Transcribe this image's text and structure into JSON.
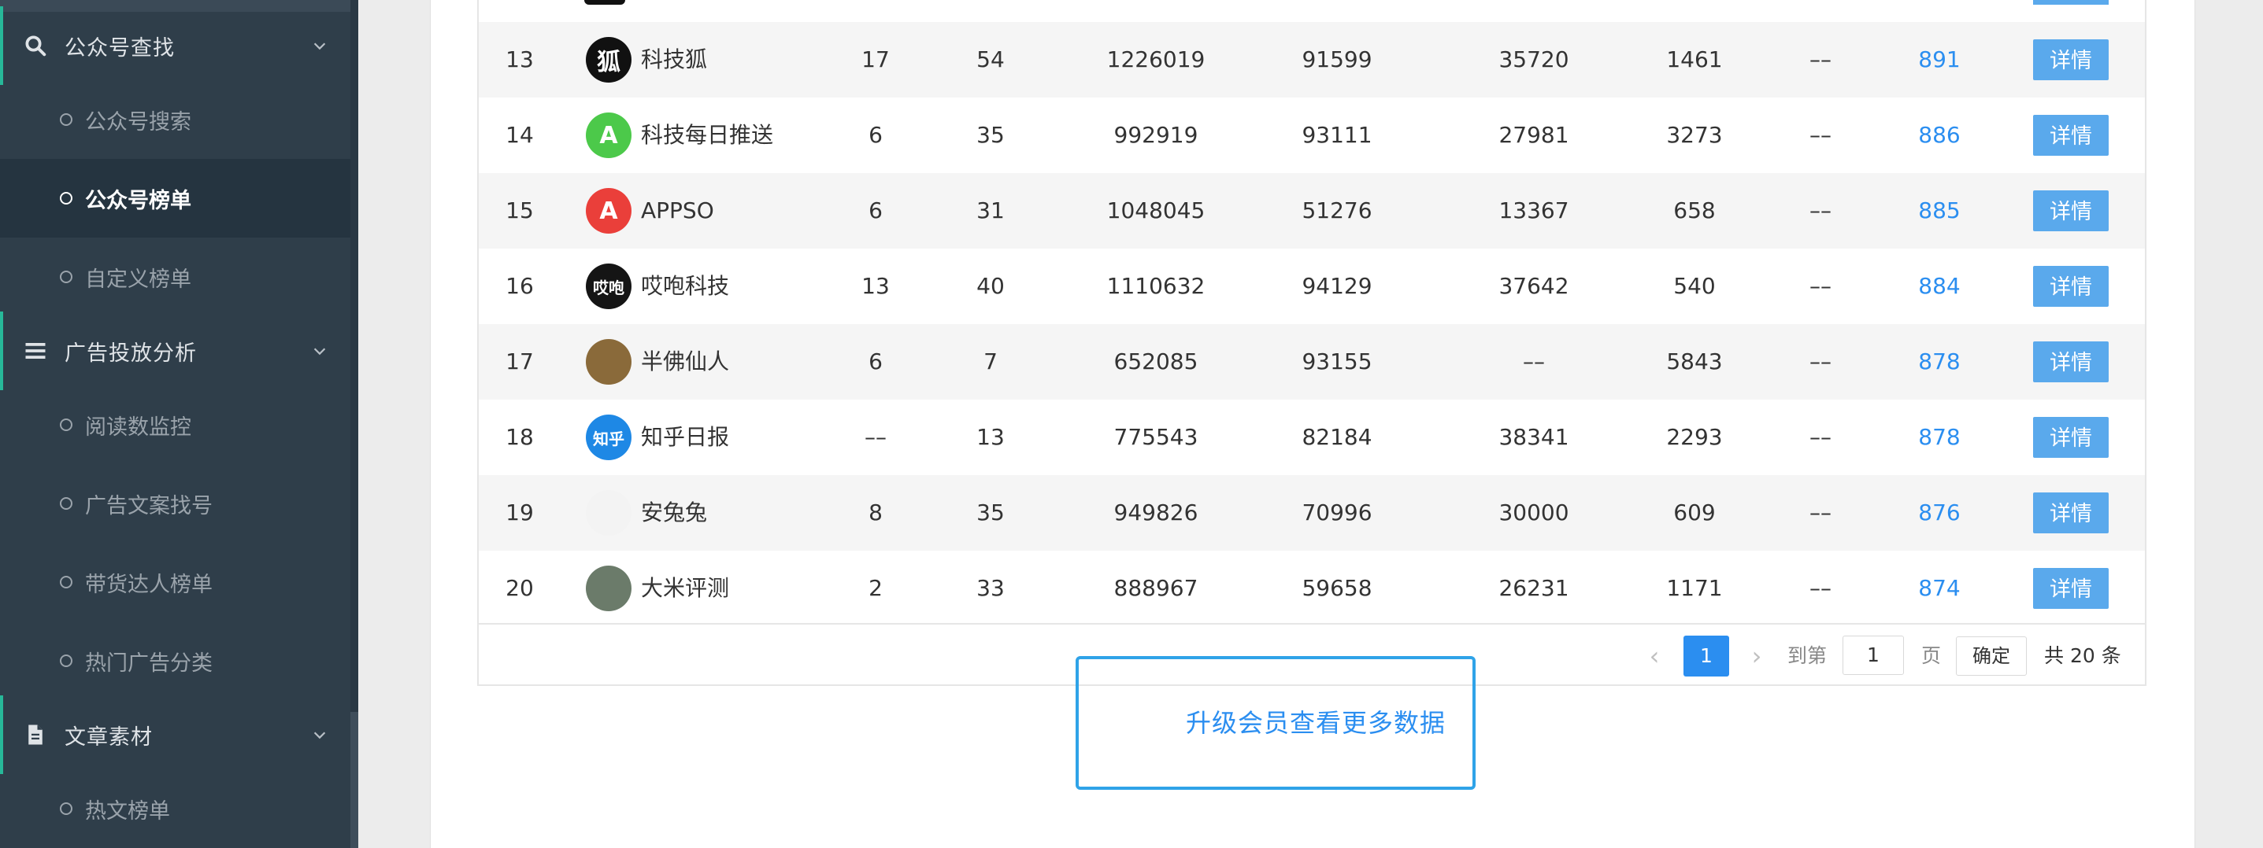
{
  "sidebar": {
    "groups": [
      {
        "label": "公众号查找",
        "icon": "search-icon"
      },
      {
        "label": "广告投放分析",
        "icon": "menu-lines-icon"
      },
      {
        "label": "文章素材",
        "icon": "document-icon"
      }
    ],
    "items": [
      {
        "label": "公众号搜索"
      },
      {
        "label": "公众号榜单"
      },
      {
        "label": "自定义榜单"
      },
      {
        "label": "阅读数监控"
      },
      {
        "label": "广告文案找号"
      },
      {
        "label": "带货达人榜单"
      },
      {
        "label": "热门广告分类"
      },
      {
        "label": "热文榜单"
      }
    ]
  },
  "table": {
    "detail_label": "详情",
    "rows": [
      {
        "rank": "13",
        "name": "科技狐",
        "c1": "17",
        "c2": "54",
        "c3": "1226019",
        "c4": "91599",
        "c5": "35720",
        "c6": "1461",
        "c7": "––",
        "score": "891",
        "avatar_text": "狐",
        "avatar_bg": "#111111"
      },
      {
        "rank": "14",
        "name": "科技每日推送",
        "c1": "6",
        "c2": "35",
        "c3": "992919",
        "c4": "93111",
        "c5": "27981",
        "c6": "3273",
        "c7": "––",
        "score": "886",
        "avatar_text": "A",
        "avatar_bg": "#4cc94a"
      },
      {
        "rank": "15",
        "name": "APPSO",
        "c1": "6",
        "c2": "31",
        "c3": "1048045",
        "c4": "51276",
        "c5": "13367",
        "c6": "658",
        "c7": "––",
        "score": "885",
        "avatar_text": "A",
        "avatar_bg": "#ea3f3a"
      },
      {
        "rank": "16",
        "name": "哎咆科技",
        "c1": "13",
        "c2": "40",
        "c3": "1110632",
        "c4": "94129",
        "c5": "37642",
        "c6": "540",
        "c7": "––",
        "score": "884",
        "avatar_text": "哎咆",
        "avatar_bg": "#151515"
      },
      {
        "rank": "17",
        "name": "半佛仙人",
        "c1": "6",
        "c2": "7",
        "c3": "652085",
        "c4": "93155",
        "c5": "––",
        "c6": "5843",
        "c7": "––",
        "score": "878",
        "avatar_text": "",
        "avatar_bg": "#8a6a3a"
      },
      {
        "rank": "18",
        "name": "知乎日报",
        "c1": "––",
        "c2": "13",
        "c3": "775543",
        "c4": "82184",
        "c5": "38341",
        "c6": "2293",
        "c7": "––",
        "score": "878",
        "avatar_text": "知乎",
        "avatar_bg": "#1e88e5"
      },
      {
        "rank": "19",
        "name": "安兔兔",
        "c1": "8",
        "c2": "35",
        "c3": "949826",
        "c4": "70996",
        "c5": "30000",
        "c6": "609",
        "c7": "––",
        "score": "876",
        "avatar_text": "",
        "avatar_bg": "#f3f3f3"
      },
      {
        "rank": "20",
        "name": "大米评测",
        "c1": "2",
        "c2": "33",
        "c3": "888967",
        "c4": "59658",
        "c5": "26231",
        "c6": "1171",
        "c7": "––",
        "score": "874",
        "avatar_text": "",
        "avatar_bg": "#6b7b6a"
      }
    ]
  },
  "pagination": {
    "current_page": "1",
    "goto_label": "到第",
    "goto_value": "1",
    "page_unit": "页",
    "confirm_label": "确定",
    "total_label": "共 20 条"
  },
  "upgrade": {
    "label": "升级会员查看更多数据"
  },
  "colors": {
    "accent": "#27b899",
    "link": "#2b8ef0",
    "button": "#5aa9ec",
    "sidebar_bg": "#2f3e4a"
  }
}
